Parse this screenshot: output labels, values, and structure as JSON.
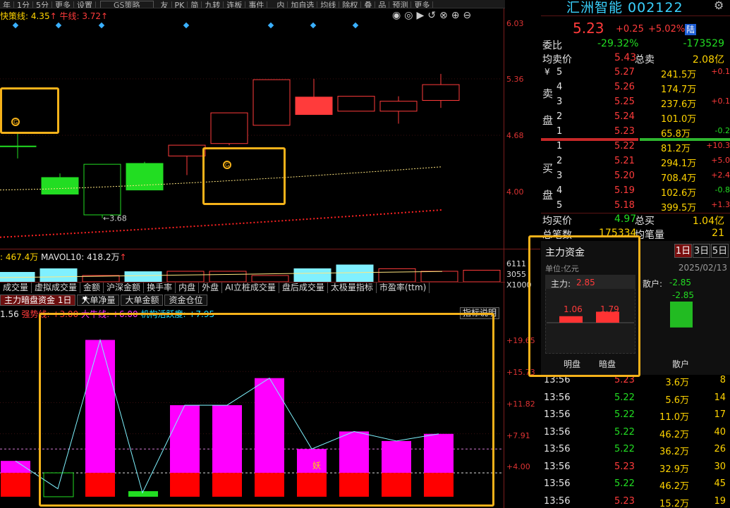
{
  "toolbar": {
    "items": [
      "年",
      "1分",
      "5分",
      "更多",
      "设置"
    ],
    "strategy": "GS策略",
    "items2": [
      "友",
      "PK",
      "简",
      "九转",
      "连板",
      "事件",
      "",
      "内",
      "加自选",
      "均线",
      "除权",
      "叠",
      "品",
      "预测",
      "更多"
    ]
  },
  "main_chart": {
    "legend_fast": "快策线: 4.35",
    "legend_bull": "牛线: 3.72",
    "price_labels": [
      "6.03",
      "5.36",
      "4.68",
      "4.00"
    ],
    "low_label": "3.68",
    "badge": "G",
    "candles": [
      {
        "o": 4.55,
        "c": 4.55,
        "h": 4.72,
        "l": 4.4,
        "color": "green"
      },
      {
        "o": 4.17,
        "c": 3.97,
        "h": 4.22,
        "l": 3.97,
        "color": "green"
      },
      {
        "o": 4.33,
        "c": 3.72,
        "h": 4.33,
        "l": 3.68,
        "color": "hollow-green"
      },
      {
        "o": 4.34,
        "c": 4.02,
        "h": 4.36,
        "l": 4.02,
        "color": "green"
      },
      {
        "o": 4.43,
        "c": 4.56,
        "h": 4.56,
        "l": 4.2,
        "color": "hollow-red"
      },
      {
        "o": 4.58,
        "c": 4.95,
        "h": 4.95,
        "l": 4.56,
        "color": "hollow-red"
      },
      {
        "o": 4.8,
        "c": 5.35,
        "h": 5.35,
        "l": 4.8,
        "color": "hollow-red"
      },
      {
        "o": 5.14,
        "c": 4.93,
        "h": 5.36,
        "l": 4.93,
        "color": "red"
      },
      {
        "o": 4.97,
        "c": 5.15,
        "h": 5.15,
        "l": 4.97,
        "color": "hollow-red"
      },
      {
        "o": 4.97,
        "c": 5.09,
        "h": 5.15,
        "l": 4.82,
        "color": "hollow-red"
      },
      {
        "o": 5.1,
        "c": 5.29,
        "h": 5.42,
        "l": 5.01,
        "color": "hollow-red"
      }
    ]
  },
  "volume": {
    "legend_v": "467.4万",
    "legend_ma10": "MAVOL10: 418.2万",
    "labels": [
      "6111",
      "3055",
      "X1000"
    ],
    "bars": [
      0.45,
      0.62,
      0.3,
      0.48,
      0.5,
      0.5,
      0.3,
      0.62,
      0.8,
      0.62,
      0.5,
      0.55
    ]
  },
  "tabs": [
    "成交量",
    "虚拟成交量",
    "金额",
    "沪深金额",
    "换手率",
    "内盘",
    "外盘",
    "AI立桩成交量",
    "盘后成交量",
    "太极量指标",
    "市盈率(ttm)"
  ],
  "sub_tabs": [
    "主力暗盘资金 1日",
    "大单净量",
    "大单金额",
    "资金仓位"
  ],
  "indicator": {
    "legend_prefix": "1.56",
    "legend_strong": "强势线: +3.00",
    "legend_bull": "大牛线: +6.00",
    "legend_active": "机构活跃度: +7.95",
    "help_button": "指标说明",
    "labels": [
      "+19.65",
      "+15.73",
      "+11.82",
      "+7.91",
      "+4.00"
    ],
    "yao": "妖",
    "bars": [
      4.5,
      1.0,
      19.7,
      0.5,
      11.5,
      11.5,
      14.9,
      6.0,
      8.2,
      7.0,
      7.9
    ],
    "line": [
      4.5,
      1.0,
      19.7,
      0.5,
      11.5,
      11.5,
      14.9,
      6.0,
      8.2,
      7.0,
      7.9
    ]
  },
  "quote": {
    "name": "汇洲智能 002122",
    "price": "5.23",
    "change": "+0.25",
    "change_pct": "+5.02%",
    "badge": "陆",
    "weibi_label": "委比",
    "weibi": "-29.32%",
    "weicha": "-173529",
    "avg_sell_label": "均卖价",
    "avg_sell": "5.43",
    "total_sell_label": "总卖",
    "total_sell": "2.08亿",
    "sell_side_label": [
      "卖",
      "盘"
    ],
    "buy_side_label": [
      "买",
      "盘"
    ],
    "yen": "¥",
    "asks": [
      {
        "lvl": "5",
        "price": "5.27",
        "vol": "241.5万",
        "chg": "+0.1"
      },
      {
        "lvl": "4",
        "price": "5.26",
        "vol": "174.7万",
        "chg": ""
      },
      {
        "lvl": "3",
        "price": "5.25",
        "vol": "237.6万",
        "chg": "+0.1"
      },
      {
        "lvl": "2",
        "price": "5.24",
        "vol": "101.0万",
        "chg": ""
      },
      {
        "lvl": "1",
        "price": "5.23",
        "vol": "65.8万",
        "chg": "-0.2"
      }
    ],
    "bids": [
      {
        "lvl": "1",
        "price": "5.22",
        "vol": "81.2万",
        "chg": "+10.3"
      },
      {
        "lvl": "2",
        "price": "5.21",
        "vol": "294.1万",
        "chg": "+5.0"
      },
      {
        "lvl": "3",
        "price": "5.20",
        "vol": "708.4万",
        "chg": "+2.4"
      },
      {
        "lvl": "4",
        "price": "5.19",
        "vol": "102.6万",
        "chg": "-0.8"
      },
      {
        "lvl": "5",
        "price": "5.18",
        "vol": "399.5万",
        "chg": "+1.3"
      }
    ],
    "avg_buy_label": "均买价",
    "avg_buy": "4.97",
    "total_buy_label": "总买",
    "total_buy": "1.04亿",
    "total_deals_label": "总笔数",
    "total_deals": "175334",
    "avg_deal_label": "均笔量",
    "avg_deal": "21"
  },
  "main_force": {
    "title": "主力资金",
    "tabs": [
      "1日",
      "3日",
      "5日"
    ],
    "unit": "单位:亿元",
    "date": "2025/02/13",
    "main_label": "主力:",
    "main_value": "2.85",
    "retail_label": "散户:",
    "retail_value": "-2.85",
    "ming_value": "1.06",
    "an_value": "1.79",
    "retail_bar_value": "-2.85",
    "ming_label": "明盘",
    "an_label": "暗盘",
    "retail_bar_label": "散户"
  },
  "ticks": [
    {
      "time": "13:56",
      "price": "5.23",
      "vol": "3.6万",
      "n": "8"
    },
    {
      "time": "13:56",
      "price": "5.22",
      "vol": "5.6万",
      "n": "14"
    },
    {
      "time": "13:56",
      "price": "5.22",
      "vol": "11.0万",
      "n": "17"
    },
    {
      "time": "13:56",
      "price": "5.22",
      "vol": "46.2万",
      "n": "40"
    },
    {
      "time": "13:56",
      "price": "5.22",
      "vol": "36.2万",
      "n": "26"
    },
    {
      "time": "13:56",
      "price": "5.23",
      "vol": "32.9万",
      "n": "30"
    },
    {
      "time": "13:56",
      "price": "5.22",
      "vol": "46.2万",
      "n": "45"
    },
    {
      "time": "13:56",
      "price": "5.23",
      "vol": "15.2万",
      "n": "19"
    }
  ],
  "colors": {
    "up": "#ff3b3b",
    "down": "#22dd22",
    "highlight": "#f5b21a",
    "magenta": "#ff00ff"
  }
}
